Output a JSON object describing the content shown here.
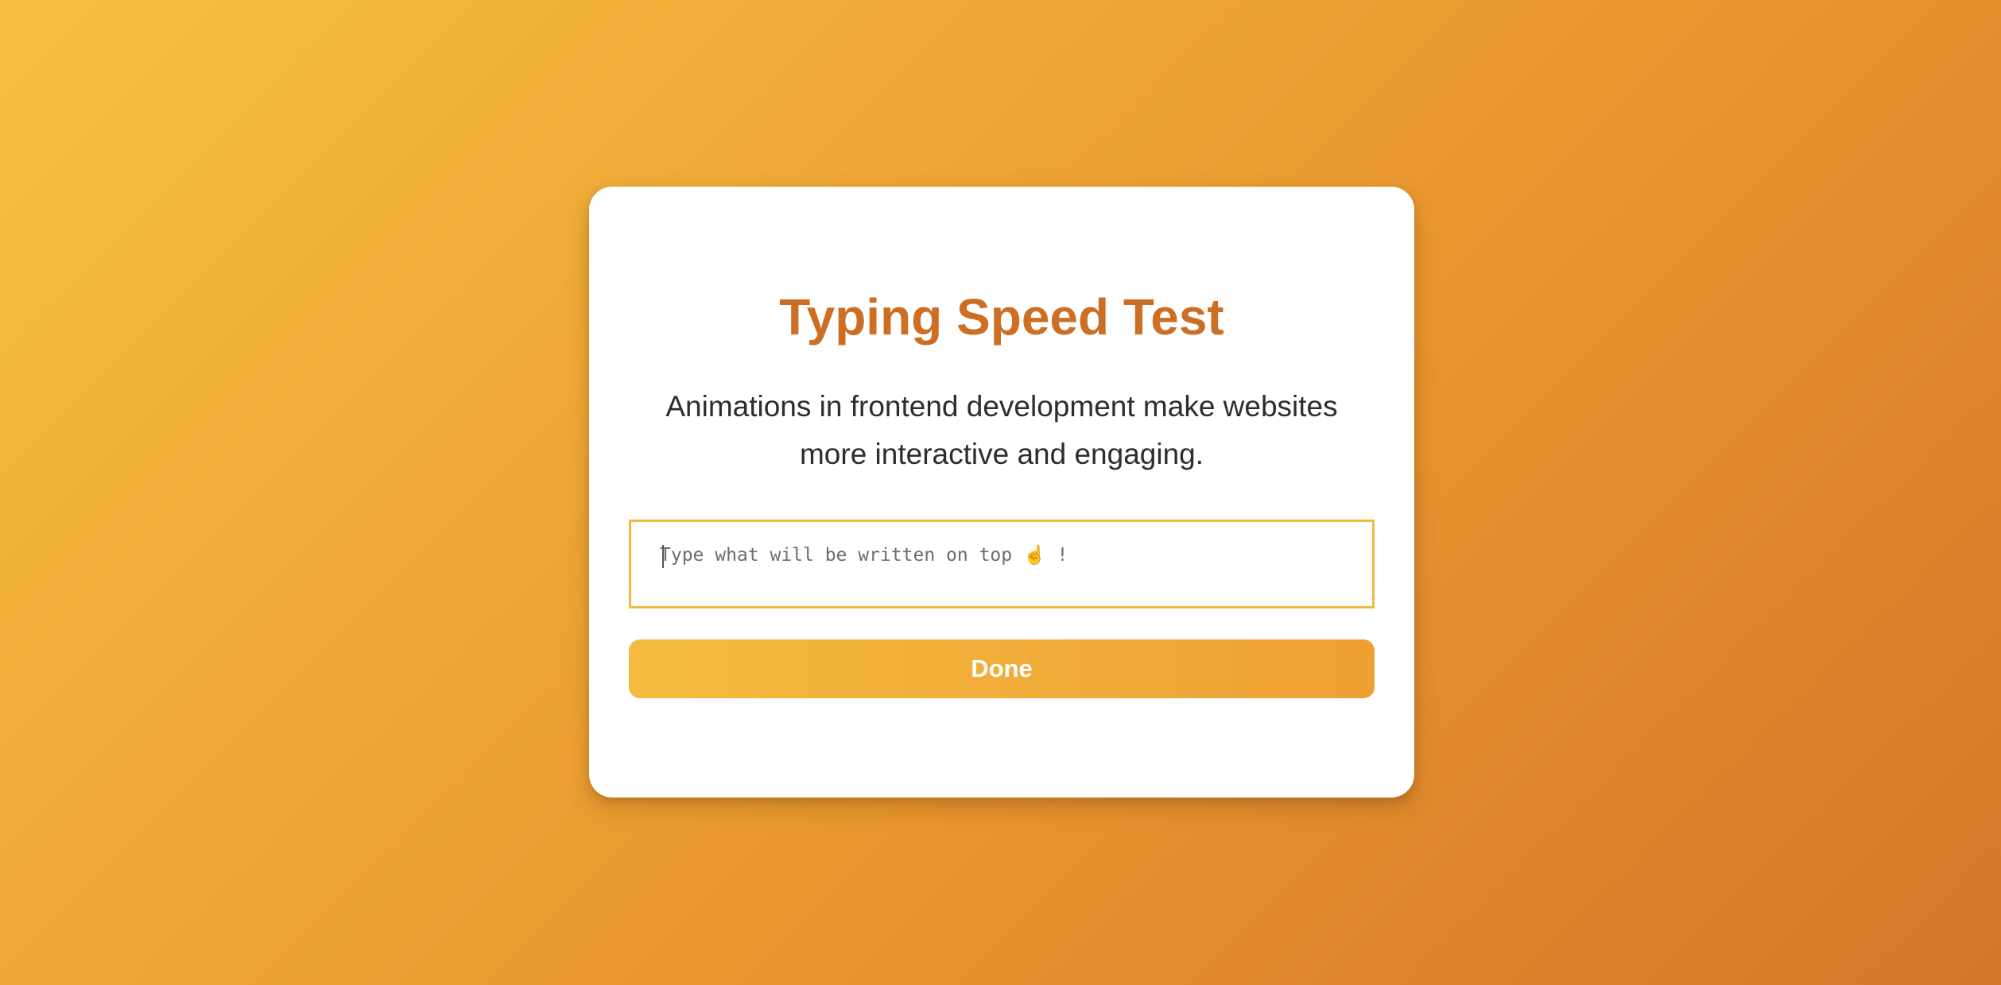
{
  "app": {
    "title": "Typing Speed Test"
  },
  "test": {
    "sentence": "Animations in frontend development make websites more interactive and engaging."
  },
  "input": {
    "placeholder": "Type what will be written on top ☝️ !",
    "value": ""
  },
  "actions": {
    "done_label": "Done"
  },
  "colors": {
    "accent": "#cc6f24",
    "input_border": "#f4b940",
    "button_start": "#f4bb40",
    "button_end": "#eea032",
    "background_start": "#f5c043",
    "background_end": "#d4762a"
  }
}
